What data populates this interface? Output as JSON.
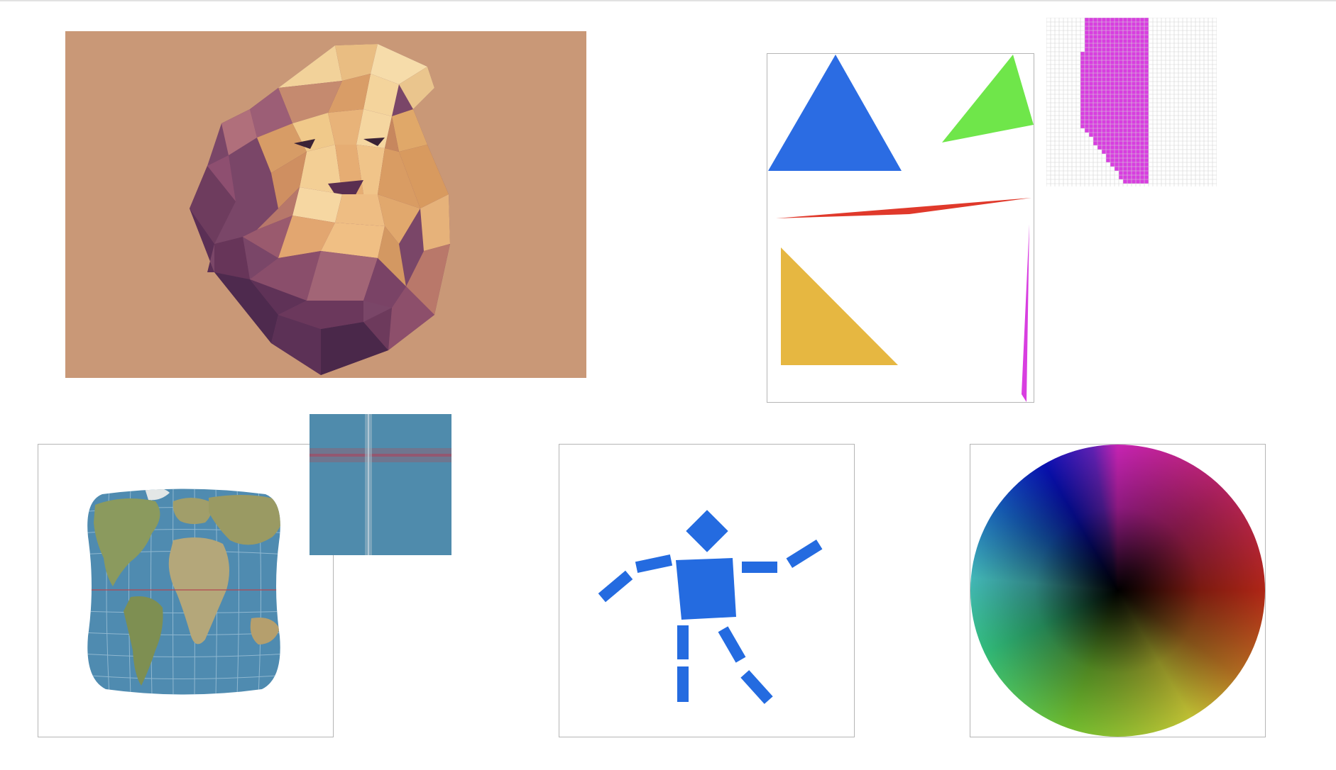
{
  "scene": {
    "colors": {
      "canvas_bg": "#ffffff",
      "frame_border": "#b5b5b5",
      "lion_bg": "#c99877",
      "lion_light": "#f0c98a",
      "lion_mid": "#d9a46a",
      "lion_shadow": "#a8707a",
      "lion_dark": "#6e3c5e",
      "lion_deep": "#4e2a4e",
      "triangle_blue": "#2b6ce3",
      "triangle_green": "#6fe64a",
      "triangle_red": "#e0392b",
      "triangle_yellow": "#e6b741",
      "triangle_magenta": "#d83ee0",
      "pixel_grid_line": "#d4d4d4",
      "figure_blue": "#246be0",
      "globe_ocean": "#4f8bb0",
      "texture_overlay": "#4a8fb0",
      "wheel_center": "#000000"
    },
    "panels": [
      {
        "name": "lowpoly-lion",
        "icon": "lion-icon"
      },
      {
        "name": "triangle-rasterizer",
        "icon": "triangle-icon"
      },
      {
        "name": "pixel-grid-zoom",
        "icon": "grid-icon"
      },
      {
        "name": "globe-projection",
        "icon": "globe-icon"
      },
      {
        "name": "texture-swatch",
        "icon": "texture-icon"
      },
      {
        "name": "stick-figure",
        "icon": "figure-icon"
      },
      {
        "name": "color-wheel",
        "icon": "color-wheel-icon"
      }
    ]
  }
}
